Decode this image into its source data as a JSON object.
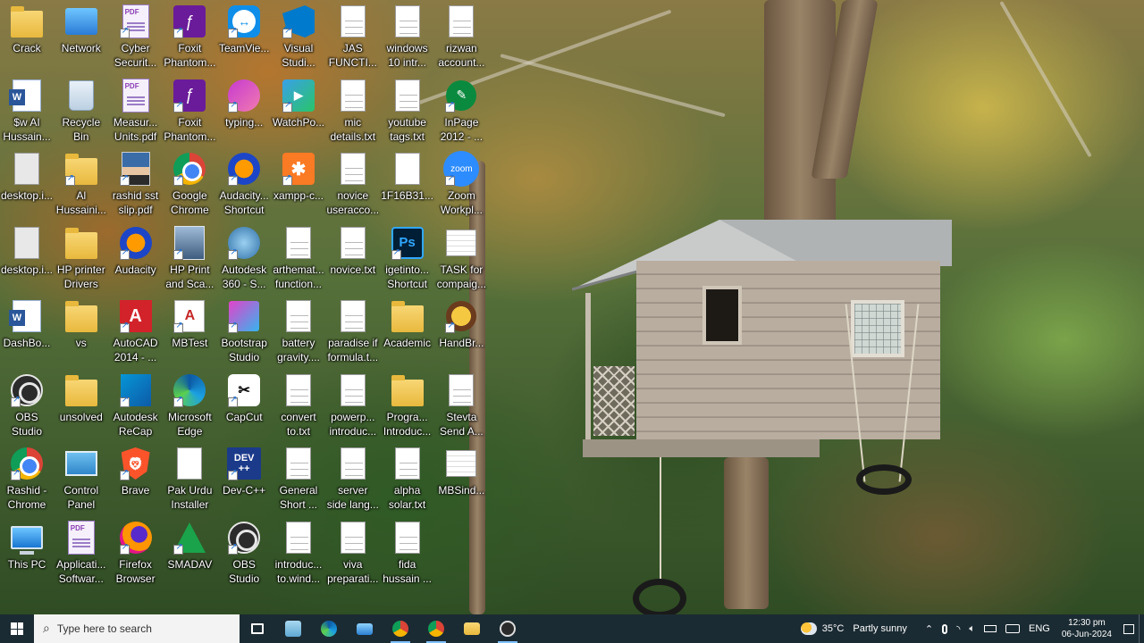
{
  "desktop": {
    "icons": [
      {
        "id": "crack",
        "label": "Crack",
        "icon": "folder-icon"
      },
      {
        "id": "network",
        "label": "Network",
        "icon": "network-icon"
      },
      {
        "id": "cyber",
        "label": "Cyber\nSecurit...",
        "icon": "pdf-icon"
      },
      {
        "id": "foxit1",
        "label": "Foxit\nPhantom...",
        "icon": "foxit-icon"
      },
      {
        "id": "teamviewer",
        "label": "TeamVie...",
        "icon": "teamviewer-icon"
      },
      {
        "id": "vs",
        "label": "Visual\nStudi...",
        "icon": "visual-studio-icon"
      },
      {
        "id": "jas",
        "label": "JAS\nFUNCTI...",
        "icon": "text-file-icon"
      },
      {
        "id": "win10",
        "label": "windows\n10 intr...",
        "icon": "text-file-icon"
      },
      {
        "id": "rizwan",
        "label": "rizwan\naccount...",
        "icon": "text-file-icon"
      },
      {
        "id": "swai",
        "label": "$w AI\nHussain...",
        "icon": "word-icon"
      },
      {
        "id": "recycle",
        "label": "Recycle\nBin",
        "icon": "recycle-bin-icon"
      },
      {
        "id": "measur",
        "label": "Measur...\nUnits.pdf",
        "icon": "pdf-icon"
      },
      {
        "id": "foxit2",
        "label": "Foxit\nPhantom...",
        "icon": "foxit-icon"
      },
      {
        "id": "typing",
        "label": "typing...",
        "icon": "typing-icon"
      },
      {
        "id": "watchpo",
        "label": "WatchPo...",
        "icon": "watchpoint-icon"
      },
      {
        "id": "mic",
        "label": "mic\ndetails.txt",
        "icon": "text-file-icon"
      },
      {
        "id": "yt",
        "label": "youtube\ntags.txt",
        "icon": "text-file-icon"
      },
      {
        "id": "inpage",
        "label": "InPage\n2012 - ...",
        "icon": "inpage-icon"
      },
      {
        "id": "desktop1",
        "label": "desktop.i...",
        "icon": "settings-file-icon"
      },
      {
        "id": "aihus",
        "label": "Al\nHussaini...",
        "icon": "folder-user-icon"
      },
      {
        "id": "rashidslip",
        "label": "rashid sst\nslip.pdf",
        "icon": "photo-id-icon"
      },
      {
        "id": "chrome",
        "label": "Google\nChrome",
        "icon": "chrome-icon"
      },
      {
        "id": "audacity-sc",
        "label": "Audacity...\nShortcut",
        "icon": "audacity-icon"
      },
      {
        "id": "xampp",
        "label": "xampp-c...",
        "icon": "xampp-icon"
      },
      {
        "id": "novice",
        "label": "novice\nuseracco...",
        "icon": "text-file-icon"
      },
      {
        "id": "1f16",
        "label": "1F16B31...",
        "icon": "blank-file-icon"
      },
      {
        "id": "zoom",
        "label": "Zoom\nWorkpl...",
        "icon": "zoom-icon"
      },
      {
        "id": "desktop2",
        "label": "desktop.i...",
        "icon": "settings-file-icon"
      },
      {
        "id": "hpdrivers",
        "label": "HP printer\nDrivers",
        "icon": "folder-icon"
      },
      {
        "id": "audacity",
        "label": "Audacity",
        "icon": "audacity-icon"
      },
      {
        "id": "hpprint",
        "label": "HP Print\nand Sca...",
        "icon": "hp-scan-icon"
      },
      {
        "id": "autodesk360",
        "label": "Autodesk\n360 - S...",
        "icon": "autodesk-360-icon"
      },
      {
        "id": "arthemat",
        "label": "arthemat...\nfunction...",
        "icon": "text-file-icon"
      },
      {
        "id": "novicetxt",
        "label": "novice.txt",
        "icon": "text-file-icon"
      },
      {
        "id": "igetinto",
        "label": "igetinto...\nShortcut",
        "icon": "photoshop-icon"
      },
      {
        "id": "task",
        "label": "TASK for\ncompaig...",
        "icon": "document-icon"
      },
      {
        "id": "dashbo",
        "label": "DashBo...",
        "icon": "word-icon"
      },
      {
        "id": "vsfolder",
        "label": "vs",
        "icon": "folder-icon"
      },
      {
        "id": "autocad",
        "label": "AutoCAD\n2014 - ...",
        "icon": "autocad-icon"
      },
      {
        "id": "mbtest",
        "label": "MBTest",
        "icon": "mbtest-icon"
      },
      {
        "id": "bootstrap",
        "label": "Bootstrap\nStudio",
        "icon": "bootstrap-studio-icon"
      },
      {
        "id": "battery",
        "label": "battery\ngravity....",
        "icon": "text-file-icon"
      },
      {
        "id": "paradise",
        "label": "paradise if\nformula.t...",
        "icon": "text-file-icon"
      },
      {
        "id": "academic",
        "label": "Academic",
        "icon": "folder-icon"
      },
      {
        "id": "handbr",
        "label": "HandBr...",
        "icon": "handbrake-icon"
      },
      {
        "id": "obs1",
        "label": "OBS\nStudio",
        "icon": "obs-icon"
      },
      {
        "id": "unsolved",
        "label": "unsolved",
        "icon": "folder-icon"
      },
      {
        "id": "recap",
        "label": "Autodesk\nReCap",
        "icon": "recap-icon"
      },
      {
        "id": "edge",
        "label": "Microsoft\nEdge",
        "icon": "edge-icon"
      },
      {
        "id": "capcut",
        "label": "CapCut",
        "icon": "capcut-icon"
      },
      {
        "id": "convert",
        "label": "convert\nto.txt",
        "icon": "text-file-icon"
      },
      {
        "id": "powerp",
        "label": "powerp...\nintroduc...",
        "icon": "text-file-icon"
      },
      {
        "id": "progra",
        "label": "Progra...\nIntroduc...",
        "icon": "folder-icon"
      },
      {
        "id": "stevta",
        "label": "Stevta\nSend A...",
        "icon": "text-file-icon"
      },
      {
        "id": "rashidchrome",
        "label": "Rashid -\nChrome",
        "icon": "chrome-icon"
      },
      {
        "id": "control",
        "label": "Control\nPanel",
        "icon": "control-panel-icon"
      },
      {
        "id": "brave",
        "label": "Brave",
        "icon": "brave-icon"
      },
      {
        "id": "pakurdu",
        "label": "Pak Urdu\nInstaller",
        "icon": "blank-file-icon"
      },
      {
        "id": "devcpp",
        "label": "Dev-C++",
        "icon": "dev-cpp-icon"
      },
      {
        "id": "general",
        "label": "General\nShort ...",
        "icon": "text-file-icon"
      },
      {
        "id": "server",
        "label": "server\nside lang...",
        "icon": "text-file-icon"
      },
      {
        "id": "alpha",
        "label": "alpha\nsolar.txt",
        "icon": "text-file-icon"
      },
      {
        "id": "mbsind",
        "label": "MBSind...",
        "icon": "document-icon"
      },
      {
        "id": "thispc",
        "label": "This PC",
        "icon": "this-pc-icon"
      },
      {
        "id": "applicati",
        "label": "Applicati...\nSoftwar...",
        "icon": "pdf-icon"
      },
      {
        "id": "firefox",
        "label": "Firefox\nBrowser",
        "icon": "firefox-icon"
      },
      {
        "id": "smadav",
        "label": "SMADAV",
        "icon": "smadav-icon"
      },
      {
        "id": "obs2",
        "label": "OBS\nStudio",
        "icon": "obs-icon"
      },
      {
        "id": "introduc",
        "label": "introduc...\nto.wind...",
        "icon": "text-file-icon"
      },
      {
        "id": "viva",
        "label": "viva\npreparati...",
        "icon": "text-file-icon"
      },
      {
        "id": "fida",
        "label": "fida\nhussain ...",
        "icon": "text-file-icon"
      }
    ]
  },
  "taskbar": {
    "search_placeholder": "Type here to search",
    "apps": [
      {
        "name": "task-view",
        "icon": "task-view-icon"
      },
      {
        "name": "notepad",
        "icon": "notepad-icon"
      },
      {
        "name": "edge",
        "icon": "edge-icon"
      },
      {
        "name": "desktop-app",
        "icon": "computer-icon"
      },
      {
        "name": "chrome",
        "icon": "chrome-icon"
      },
      {
        "name": "chrome-profile",
        "icon": "chrome-icon"
      },
      {
        "name": "file-explorer",
        "icon": "folder-icon"
      },
      {
        "name": "obs-recording",
        "icon": "obs-icon"
      }
    ],
    "weather": {
      "temp": "35°C",
      "desc": "Partly sunny"
    },
    "language": "ENG",
    "time": "12:30 pm",
    "date": "06-Jun-2024"
  }
}
